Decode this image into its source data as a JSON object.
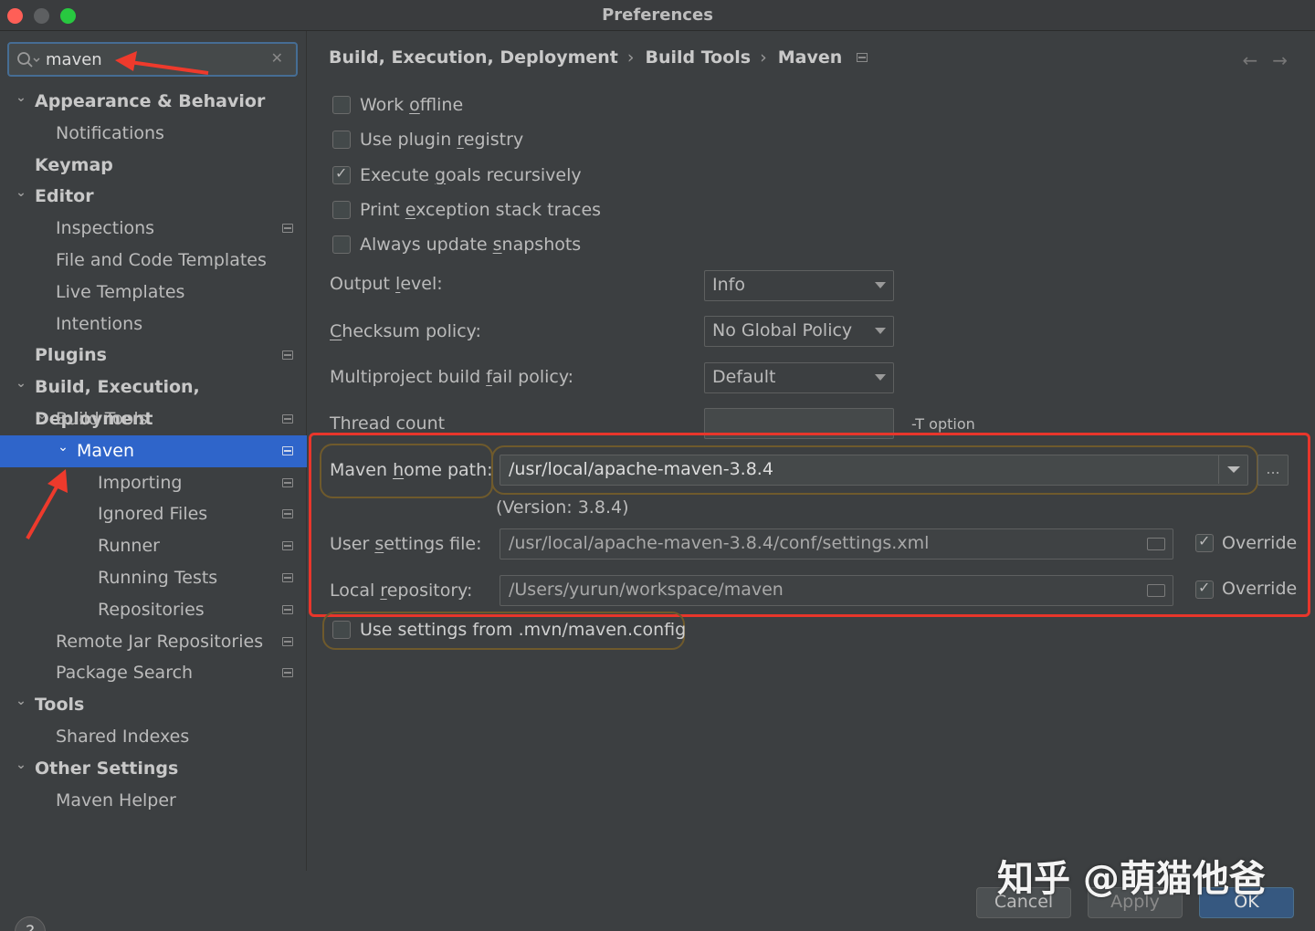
{
  "window": {
    "title": "Preferences"
  },
  "search": {
    "value": "maven",
    "clear_glyph": "✕"
  },
  "sidebar": {
    "items": [
      {
        "label": "Appearance & Behavior",
        "level": 0,
        "expanded": true,
        "bold": true
      },
      {
        "label": "Notifications",
        "level": 1
      },
      {
        "label": "Keymap",
        "level": 0,
        "bold": true
      },
      {
        "label": "Editor",
        "level": 0,
        "expanded": true,
        "bold": true
      },
      {
        "label": "Inspections",
        "level": 1,
        "project_icon": true
      },
      {
        "label": "File and Code Templates",
        "level": 1
      },
      {
        "label": "Live Templates",
        "level": 1
      },
      {
        "label": "Intentions",
        "level": 1
      },
      {
        "label": "Plugins",
        "level": 0,
        "bold": true,
        "project_icon": true
      },
      {
        "label": "Build, Execution, Deployment",
        "level": 0,
        "expanded": true,
        "bold": true
      },
      {
        "label": "Build Tools",
        "level": 1,
        "expanded": true,
        "project_icon": true
      },
      {
        "label": "Maven",
        "level": 2,
        "expanded": true,
        "selected": true,
        "project_icon": true
      },
      {
        "label": "Importing",
        "level": 3,
        "project_icon": true
      },
      {
        "label": "Ignored Files",
        "level": 3,
        "project_icon": true
      },
      {
        "label": "Runner",
        "level": 3,
        "project_icon": true
      },
      {
        "label": "Running Tests",
        "level": 3,
        "project_icon": true
      },
      {
        "label": "Repositories",
        "level": 3,
        "project_icon": true
      },
      {
        "label": "Remote Jar Repositories",
        "level": 1,
        "project_icon": true
      },
      {
        "label": "Package Search",
        "level": 1,
        "project_icon": true
      },
      {
        "label": "Tools",
        "level": 0,
        "expanded": true,
        "bold": true
      },
      {
        "label": "Shared Indexes",
        "level": 1
      },
      {
        "label": "Other Settings",
        "level": 0,
        "expanded": true,
        "bold": true
      },
      {
        "label": "Maven Helper",
        "level": 1
      }
    ],
    "help_label": "?"
  },
  "breadcrumb": {
    "items": [
      "Build, Execution, Deployment",
      "Build Tools",
      "Maven"
    ],
    "separator": "›",
    "back": "←",
    "forward": "→"
  },
  "settings": {
    "work_offline": {
      "pre": "Work ",
      "u": "o",
      "post": "ffline",
      "checked": false
    },
    "use_plugin_registry": {
      "pre": "Use plugin ",
      "u": "r",
      "post": "egistry",
      "checked": false
    },
    "execute_goals": {
      "pre": "Execute ",
      "u": "g",
      "post": "oals recursively",
      "checked": true
    },
    "print_exception": {
      "pre": "Print ",
      "u": "e",
      "post": "xception stack traces",
      "checked": false
    },
    "always_update": {
      "pre": "Always update ",
      "u": "s",
      "post": "napshots",
      "checked": false
    },
    "output_level": {
      "pre": "Output ",
      "u": "l",
      "post": "evel:",
      "value": "Info"
    },
    "checksum_policy": {
      "pre": "",
      "u": "C",
      "post": "hecksum policy:",
      "value": "No Global Policy"
    },
    "multiproject_policy": {
      "pre": "Multiproject build ",
      "u": "f",
      "post": "ail policy:",
      "value": "Default"
    },
    "thread_count": {
      "label": "Thread count",
      "value": "",
      "hint": "-T option"
    },
    "maven_home": {
      "pre": "Maven ",
      "u": "h",
      "post": "ome path:",
      "value": "/usr/local/apache-maven-3.8.4",
      "version": "(Version: 3.8.4)",
      "ellipsis": "..."
    },
    "user_settings": {
      "pre": "User ",
      "u": "s",
      "post": "ettings file:",
      "value": "/usr/local/apache-maven-3.8.4/conf/settings.xml",
      "override_label": "Override",
      "override": true
    },
    "local_repo": {
      "pre": "Local ",
      "u": "r",
      "post": "epository:",
      "value": "/Users/yurun/workspace/maven",
      "override_label": "Override",
      "override": true
    },
    "mvn_config": {
      "label": "Use settings from .mvn/maven.config",
      "checked": false
    }
  },
  "buttons": {
    "cancel": "Cancel",
    "apply": "Apply",
    "ok": "OK"
  },
  "watermark": "知乎 @萌猫他爸",
  "colors": {
    "selection": "#2f65ca",
    "highlight_box": "#e8362b",
    "annotation_arrow": "#ee3a2c",
    "ok_button": "#365880"
  }
}
